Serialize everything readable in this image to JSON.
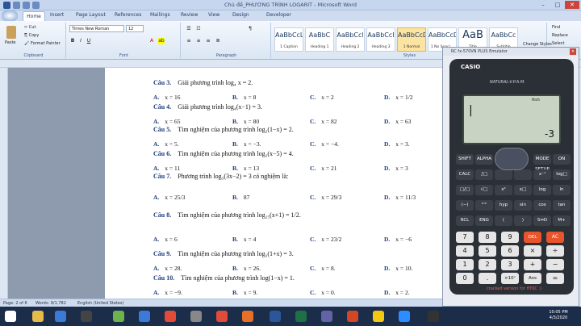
{
  "window": {
    "title": "Chủ đề_PHƯƠNG TRÌNH LOGARIT - Microsoft Word"
  },
  "tabs": [
    "Home",
    "Insert",
    "Page Layout",
    "References",
    "Mailings",
    "Review",
    "View",
    "Design",
    "Developer"
  ],
  "ribbon": {
    "clipboard": {
      "label": "Clipboard",
      "paste": "Paste",
      "cut": "Cut",
      "copy": "Copy",
      "format_painter": "Format Painter"
    },
    "font": {
      "label": "Font",
      "name": "Times New Roman",
      "size": "12",
      "bold": "B",
      "italic": "I",
      "underline": "U"
    },
    "paragraph": {
      "label": "Paragraph"
    },
    "styles": {
      "label": "Styles",
      "items": [
        {
          "sample": "AaBbCcL",
          "name": "1 Caption"
        },
        {
          "sample": "AaBbC",
          "name": "Heading 1"
        },
        {
          "sample": "AaBbCcl",
          "name": "Heading 2"
        },
        {
          "sample": "AaBbCcI",
          "name": "Heading 3"
        },
        {
          "sample": "AaBbCcD",
          "name": "1 Normal"
        },
        {
          "sample": "AaBbCcD",
          "name": "1 No Spaci..."
        },
        {
          "sample": "AaB",
          "name": "Title"
        },
        {
          "sample": "AaBbCc",
          "name": "Subtitle"
        }
      ],
      "change_styles": "Change Styles"
    },
    "editing": {
      "find": "Find",
      "replace": "Replace",
      "select": "Select"
    }
  },
  "questions": [
    {
      "num": "Câu 3.",
      "text": "Giải phương trình log₄ x = 2.",
      "opts": [
        "x = 16",
        "x = 8",
        "x = 2",
        "x = 1/2"
      ]
    },
    {
      "num": "Câu 4.",
      "text": "Giải phương trình log₄(x−1) = 3.",
      "opts": [
        "x = 65",
        "x = 80",
        "x = 82",
        "x = 63"
      ]
    },
    {
      "num": "Câu 5.",
      "text": "Tìm nghiệm của phương trình log₂(1−x) = 2.",
      "opts": [
        "x = 5.",
        "x = −3.",
        "x = −4.",
        "x = 3."
      ]
    },
    {
      "num": "Câu 6.",
      "text": "Tìm nghiệm của phương trình log₂(x−5) = 4.",
      "opts": [
        "x = 11",
        "x = 13",
        "x = 21",
        "x = 3"
      ]
    },
    {
      "num": "Câu 7.",
      "text": "Phương trình log₃(3x−2) = 3 có nghiệm là:",
      "opts": [
        "x = 25/3",
        "87",
        "x = 29/3",
        "x = 11/3"
      ]
    },
    {
      "num": "Câu 8.",
      "text": "Tìm nghiệm của phương trình log₂₅(x+1) = 1/2.",
      "opts": [
        "x = 6",
        "x = 4",
        "x = 23/2",
        "x = −6"
      ]
    },
    {
      "num": "Câu 9.",
      "text": "Tìm nghiệm của phương trình log₃(1+x) = 3.",
      "opts": [
        "x = 28.",
        "x = 26.",
        "x = 8.",
        "x = 10."
      ]
    },
    {
      "num": "Câu 10.",
      "text": "Tìm nghiệm của phương trình log(1−x) = 1.",
      "opts": [
        "x = −9.",
        "x = 9.",
        "x = 0.",
        "x = 2."
      ]
    }
  ],
  "option_letters": [
    "A.",
    "B.",
    "C.",
    "D."
  ],
  "status": {
    "page": "Page: 2 of 6",
    "words": "Words: 9/1,782",
    "language": "English (United States)"
  },
  "calculator": {
    "title": "RC fx-570VN PLUS Emulator",
    "brand": "CASIO",
    "model": "NATURAL-V.P.A.M.",
    "display_input": "|",
    "display_result": "-3",
    "mode": "Math",
    "footer": "cracked version for HTKC :)"
  },
  "calc_keys": {
    "row1": [
      "SHIFT",
      "ALPHA",
      "",
      "",
      "MODE SETUP",
      "ON"
    ],
    "row2": [
      "CALC",
      "∫□",
      "",
      "",
      "x⁻¹",
      "log□"
    ],
    "row3": [
      "□/□",
      "√□",
      "x²",
      "x□",
      "log",
      "ln"
    ],
    "row4": [
      "(−)",
      "°'\"",
      "hyp",
      "sin",
      "cos",
      "tan"
    ],
    "row5": [
      "RCL",
      "ENG",
      "(",
      ")",
      "S⇔D",
      "M+"
    ],
    "nums": [
      "7",
      "8",
      "9",
      "DEL",
      "AC",
      "4",
      "5",
      "6",
      "×",
      "÷",
      "1",
      "2",
      "3",
      "+",
      "−",
      "0",
      ".",
      "×10ˣ",
      "Ans",
      "="
    ]
  },
  "clock": {
    "time": "10:05 PM",
    "date": "4/3/2020"
  },
  "colors": {
    "accent": "#1f3c7a",
    "del_ac": "#e8542c"
  }
}
